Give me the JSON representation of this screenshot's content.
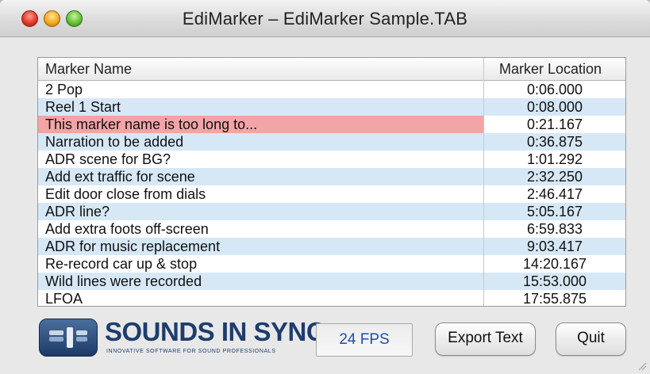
{
  "window": {
    "title": "EdiMarker – EdiMarker Sample.TAB"
  },
  "table": {
    "columns": {
      "name": "Marker Name",
      "location": "Marker Location"
    },
    "rows": [
      {
        "name": "2 Pop",
        "location": "0:06.000"
      },
      {
        "name": "Reel 1 Start",
        "location": "0:08.000"
      },
      {
        "name": "This marker name is too long to...",
        "location": "0:21.167",
        "highlight": true
      },
      {
        "name": "Narration to be added",
        "location": "0:36.875"
      },
      {
        "name": "ADR scene for BG?",
        "location": "1:01.292"
      },
      {
        "name": "Add ext traffic for scene",
        "location": "2:32.250"
      },
      {
        "name": "Edit door close from dials",
        "location": "2:46.417"
      },
      {
        "name": "ADR line?",
        "location": "5:05.167"
      },
      {
        "name": "Add extra foots off-screen",
        "location": "6:59.833"
      },
      {
        "name": "ADR for music replacement",
        "location": "9:03.417"
      },
      {
        "name": "Re-record car up & stop",
        "location": "14:20.167"
      },
      {
        "name": "Wild lines were recorded",
        "location": "15:53.000"
      },
      {
        "name": "LFOA",
        "location": "17:55.875"
      }
    ]
  },
  "logo": {
    "name": "SOUNDS IN SYNC",
    "tagline": "INNOVATIVE SOFTWARE FOR SOUND PROFESSIONALS"
  },
  "fps": {
    "value": "24 FPS"
  },
  "buttons": {
    "export": "Export Text",
    "quit": "Quit"
  },
  "colors": {
    "row_alt": "#d6e8f6",
    "highlight": "#f3a4a6",
    "fps_text": "#1d4fa8",
    "brand": "#1e3d6d"
  }
}
